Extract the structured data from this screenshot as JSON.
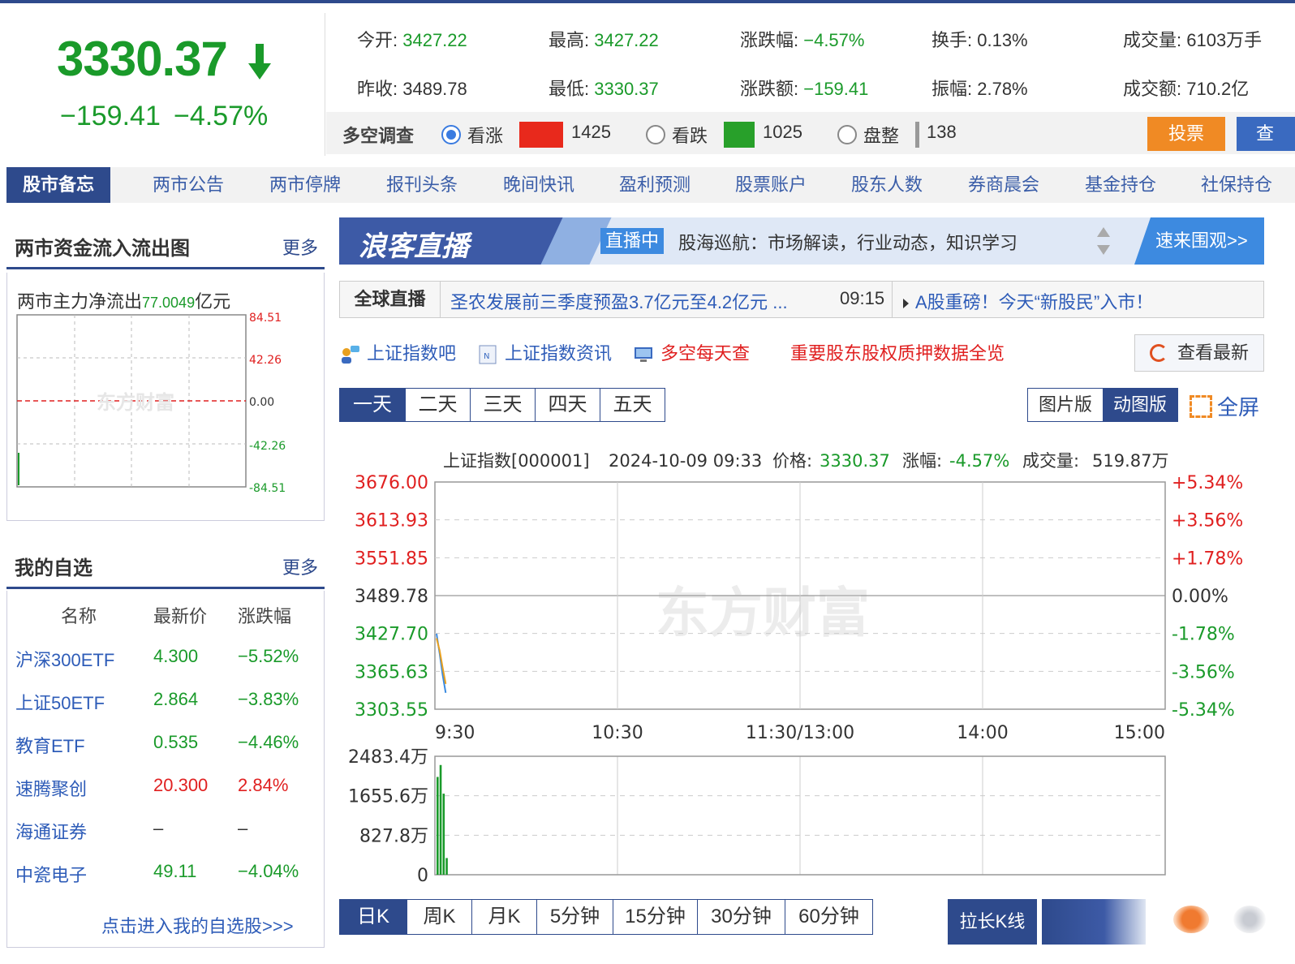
{
  "quote": {
    "price": "3330.37",
    "change": "−159.41",
    "change_pct": "−4.57%",
    "stats": [
      {
        "label": "今开: ",
        "value": "3427.22",
        "color": "green"
      },
      {
        "label": "最高: ",
        "value": "3427.22",
        "color": "green"
      },
      {
        "label": "涨跌幅: ",
        "value": "−4.57%",
        "color": "green"
      },
      {
        "label": "换手: ",
        "value": "0.13%",
        "color": ""
      },
      {
        "label": "成交量: ",
        "value": "6103万手",
        "color": ""
      },
      {
        "label": "昨收: ",
        "value": "3489.78",
        "color": ""
      },
      {
        "label": "最低: ",
        "value": "3330.37",
        "color": "green"
      },
      {
        "label": "涨跌额: ",
        "value": "−159.41",
        "color": "green"
      },
      {
        "label": "振幅: ",
        "value": "2.78%",
        "color": ""
      },
      {
        "label": "成交额: ",
        "value": "710.2亿",
        "color": ""
      }
    ]
  },
  "survey": {
    "title": "多空调查",
    "options": [
      {
        "label": "看涨",
        "count": "1425",
        "color": "#e8291c",
        "selected": true
      },
      {
        "label": "看跌",
        "count": "1025",
        "color": "#28a02a",
        "selected": false
      },
      {
        "label": "盘整",
        "count": "138",
        "color": "#999999",
        "selected": false
      }
    ],
    "vote_label": "投票",
    "query_label": "查"
  },
  "nav": {
    "items": [
      "股市备忘",
      "两市公告",
      "两市停牌",
      "报刊头条",
      "晚间快讯",
      "盈利预测",
      "股票账户",
      "股东人数",
      "券商晨会",
      "基金持仓",
      "社保持仓"
    ]
  },
  "flow_panel": {
    "title": "两市资金流入流出图",
    "more": "更多",
    "label": "两市主力净流出",
    "value": "77.0049",
    "unit": "亿元",
    "ticks": [
      "84.51",
      "42.26",
      "0.00",
      "-42.26",
      "-84.51"
    ]
  },
  "watchlist": {
    "title": "我的自选",
    "more": "更多",
    "headers": [
      "名称",
      "最新价",
      "涨跌幅"
    ],
    "rows": [
      {
        "name": "沪深300ETF",
        "price": "4.300",
        "change": "−5.52%",
        "dir": "down"
      },
      {
        "name": "上证50ETF",
        "price": "2.864",
        "change": "−3.83%",
        "dir": "down"
      },
      {
        "name": "教育ETF",
        "price": "0.535",
        "change": "−4.46%",
        "dir": "down"
      },
      {
        "name": "速腾聚创",
        "price": "20.300",
        "change": "2.84%",
        "dir": "up"
      },
      {
        "name": "海通证券",
        "price": "–",
        "change": "–",
        "dir": "flat"
      },
      {
        "name": "中瓷电子",
        "price": "49.11",
        "change": "−4.04%",
        "dir": "down"
      }
    ],
    "link": "点击进入我的自选股>>>"
  },
  "banner": {
    "logo": "浪客直播",
    "badge": "直播中",
    "text": "股海巡航：市场解读，行业动态，知识学习",
    "cta": "速来围观>>"
  },
  "ticker": {
    "label": "全球直播",
    "text": "圣农发展前三季度预盈3.7亿元至4.2亿元 ...",
    "time": "09:15",
    "text2": "A股重磅！今天“新股民”入市！"
  },
  "links": {
    "items": [
      {
        "label": "上证指数吧",
        "color": "#2e5cb8",
        "icon": "user-chat-icon"
      },
      {
        "label": "上证指数资讯",
        "color": "#2e5cb8",
        "icon": "news-icon"
      },
      {
        "label": "多空每天查",
        "color": "#e02020",
        "icon": "monitor-icon"
      },
      {
        "label": "重要股东股权质押数据全览",
        "color": "#e02020",
        "icon": ""
      }
    ],
    "refresh": "查看最新"
  },
  "day_tabs": [
    "一天",
    "二天",
    "三天",
    "四天",
    "五天"
  ],
  "mode_tabs": [
    "图片版",
    "动图版"
  ],
  "fullscreen": "全屏",
  "chart_data": {
    "type": "line",
    "info": {
      "name": "上证指数[000001]",
      "time": "2024-10-09 09:33",
      "price_label": "价格:",
      "price": "3330.37",
      "pct_label": "涨幅:",
      "pct": "-4.57%",
      "vol_label": "成交量:",
      "vol": "519.87万"
    },
    "watermark": "东方财富",
    "y_ticks": [
      "3676.00",
      "3613.93",
      "3551.85",
      "3489.78",
      "3427.70",
      "3365.63",
      "3303.55"
    ],
    "y_ticks_right": [
      "+5.34%",
      "+3.56%",
      "+1.78%",
      "0.00%",
      "-1.78%",
      "-3.56%",
      "-5.34%"
    ],
    "ylim": [
      3303.55,
      3676.0
    ],
    "x_ticks": [
      "9:30",
      "10:30",
      "11:30/13:00",
      "14:00",
      "15:00"
    ],
    "total_minutes": 240,
    "series": [
      {
        "values": [
          3427.22,
          3395.0,
          3360.0,
          3330.37
        ],
        "color": "#3a8ae0"
      },
      {
        "values": [
          3420.0,
          3400.0,
          3372.0,
          3345.0
        ],
        "color": "#e8a020"
      }
    ],
    "volume": {
      "ticks": [
        "2483.4万",
        "1655.6万",
        "827.8万",
        "0"
      ],
      "max": 2483.4,
      "values": [
        2050,
        2300,
        1700,
        350
      ]
    }
  },
  "k_tabs": [
    "日K",
    "周K",
    "月K",
    "5分钟",
    "15分钟",
    "30分钟",
    "60分钟"
  ],
  "stretch_label": "拉长K线"
}
